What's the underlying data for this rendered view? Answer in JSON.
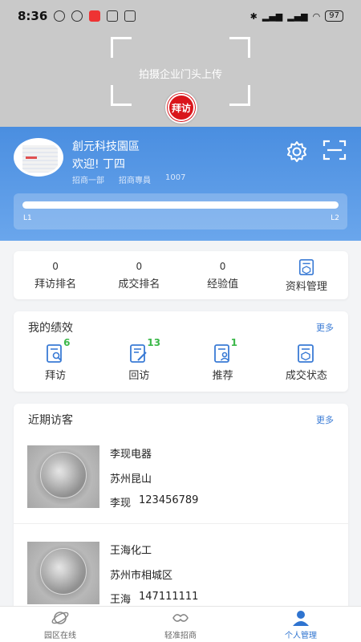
{
  "status_bar": {
    "time": "8:36",
    "battery": "97"
  },
  "camera": {
    "hint": "拍摄企业门头上传",
    "visit_button": "拜访"
  },
  "profile": {
    "company": "創元科技園區",
    "welcome": "欢迎! 丁四",
    "department": "招商一部",
    "role": "招商專員",
    "id": "1007",
    "level_start": "L1",
    "level_end": "L2",
    "level_progress": 1.0
  },
  "stats": [
    {
      "value": "0",
      "label": "拜访排名"
    },
    {
      "value": "0",
      "label": "成交排名"
    },
    {
      "value": "0",
      "label": "经验值"
    },
    {
      "label": "资料管理",
      "icon": "document-box-icon"
    }
  ],
  "performance": {
    "title": "我的绩效",
    "more": "更多",
    "items": [
      {
        "count": "6",
        "label": "拜访",
        "icon": "document-search-icon"
      },
      {
        "count": "13",
        "label": "回访",
        "icon": "document-edit-icon"
      },
      {
        "count": "1",
        "label": "推荐",
        "icon": "document-user-icon"
      },
      {
        "count": "",
        "label": "成交状态",
        "icon": "document-box-icon"
      }
    ]
  },
  "visitors": {
    "title": "近期访客",
    "more": "更多",
    "items": [
      {
        "name": "李现电器",
        "address": "苏州昆山",
        "contact": "李现",
        "phone": "123456789"
      },
      {
        "name": "王海化工",
        "address": "苏州市相城区",
        "contact": "王海",
        "phone": "147111111"
      }
    ]
  },
  "bottom_nav": [
    {
      "label": "园区在线",
      "icon": "planet-icon",
      "active": false
    },
    {
      "label": "轻准招商",
      "icon": "handshake-icon",
      "active": false
    },
    {
      "label": "个人管理",
      "icon": "person-icon",
      "active": true
    }
  ],
  "colors": {
    "primary": "#4a8ee0",
    "accent_green": "#3cb84a",
    "visit_red": "#d9151b"
  }
}
